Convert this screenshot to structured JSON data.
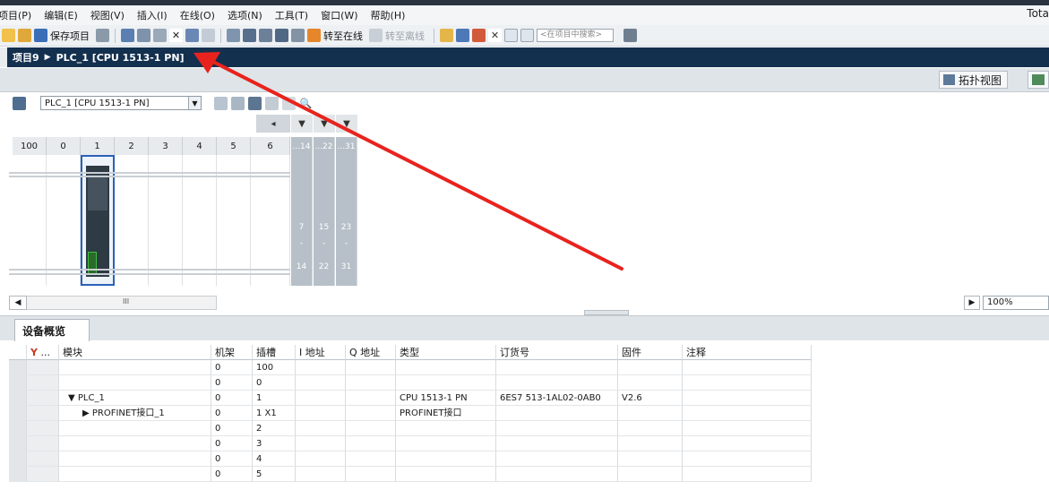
{
  "menubar": {
    "items": [
      "项目(P)",
      "编辑(E)",
      "视图(V)",
      "插入(I)",
      "在线(O)",
      "选项(N)",
      "工具(T)",
      "窗口(W)",
      "帮助(H)"
    ],
    "app_title_fragment": "Tota"
  },
  "toolbar": {
    "save_project": "保存项目",
    "go_online": "转至在线",
    "go_offline": "转至离线",
    "search_placeholder": "<在项目中搜索>"
  },
  "breadcrumb": {
    "project": "项目9",
    "device": "PLC_1 [CPU 1513-1 PN]"
  },
  "view_tabs": {
    "topology": "拓扑视图"
  },
  "device_toolbar": {
    "device_selector": "PLC_1 [CPU 1513-1 PN]"
  },
  "rack": {
    "slots": [
      "100",
      "0",
      "1",
      "2",
      "3",
      "4",
      "5",
      "6"
    ],
    "ext_headers": [
      "...14",
      "...22",
      "...31"
    ],
    "ext_top": [
      "7",
      "15",
      "23"
    ],
    "ext_dot": [
      "-",
      "-",
      "-"
    ],
    "ext_bottom": [
      "14",
      "22",
      "31"
    ]
  },
  "scroll": {
    "mark": "III",
    "zoom": "100%"
  },
  "overview": {
    "tab_label": "设备概览",
    "columns": [
      "...",
      "模块",
      "机架",
      "插槽",
      "I 地址",
      "Q 地址",
      "类型",
      "订货号",
      "固件",
      "注释"
    ],
    "rows": [
      {
        "module": "",
        "rack": "0",
        "slot": "100",
        "type": "",
        "order": "",
        "firmware": ""
      },
      {
        "module": "",
        "rack": "0",
        "slot": "0",
        "type": "",
        "order": "",
        "firmware": ""
      },
      {
        "module": "▼ PLC_1",
        "rack": "0",
        "slot": "1",
        "type": "CPU 1513-1 PN",
        "order": "6ES7 513-1AL02-0AB0",
        "firmware": "V2.6"
      },
      {
        "module": "▶ PROFINET接口_1",
        "rack": "0",
        "slot": "1 X1",
        "type": "PROFINET接口",
        "order": "",
        "firmware": ""
      },
      {
        "module": "",
        "rack": "0",
        "slot": "2",
        "type": "",
        "order": "",
        "firmware": ""
      },
      {
        "module": "",
        "rack": "0",
        "slot": "3",
        "type": "",
        "order": "",
        "firmware": ""
      },
      {
        "module": "",
        "rack": "0",
        "slot": "4",
        "type": "",
        "order": "",
        "firmware": ""
      },
      {
        "module": "",
        "rack": "0",
        "slot": "5",
        "type": "",
        "order": "",
        "firmware": ""
      }
    ]
  },
  "colors": {
    "title_bar": "#13304f",
    "annotation_arrow": "#e8231e",
    "cpu_module": "#2e3a44",
    "cpu_port": "#3fbf3f",
    "slot_selected_border": "#2a62b8"
  }
}
